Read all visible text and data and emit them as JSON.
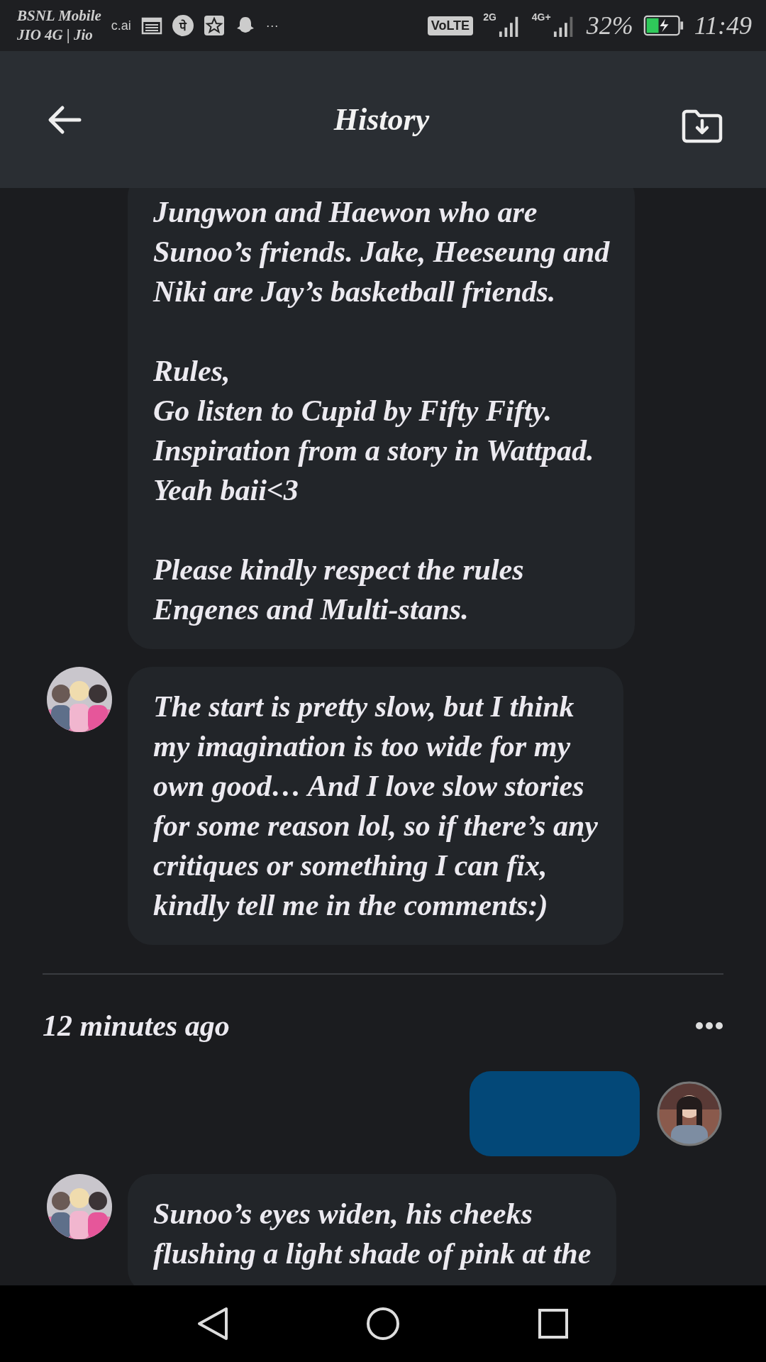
{
  "status_bar": {
    "carrier_lines": [
      "BSNL Mobile",
      "JIO 4G | Jio"
    ],
    "app_label": "c.ai",
    "payment_glyph": "पे",
    "overflow": "···",
    "volte": "VoLTE",
    "sim1": "2G",
    "sim2": "4G+",
    "battery": "32%",
    "charging": true,
    "time": "11:49"
  },
  "header": {
    "title": "History"
  },
  "thread": [
    {
      "kind": "bot_message",
      "avatar_visible": false,
      "text": "Jungwon and Haewon who are\nSunoo’s friends. Jake, Heeseung and\nNiki are Jay’s basketball friends.\n\nRules,\nGo listen to Cupid by Fifty Fifty.\nInspiration from a story in Wattpad.\nYeah baii<3\n\nPlease kindly respect the rules\nEngenes and Multi-stans."
    },
    {
      "kind": "bot_message",
      "avatar_visible": true,
      "text": "The start is pretty slow, but I think\nmy imagination is too wide for my\nown good… And I love slow stories\nfor some reason lol, so if there’s any\ncritiques or something I can fix,\nkindly tell me in the comments:)"
    },
    {
      "kind": "separator",
      "time": "12 minutes ago"
    },
    {
      "kind": "user_message",
      "avatar_visible": true
    },
    {
      "kind": "bot_message",
      "avatar_visible": true,
      "text": "Sunoo’s eyes widen, his cheeks\nflushing a light shade of pink at the"
    }
  ]
}
